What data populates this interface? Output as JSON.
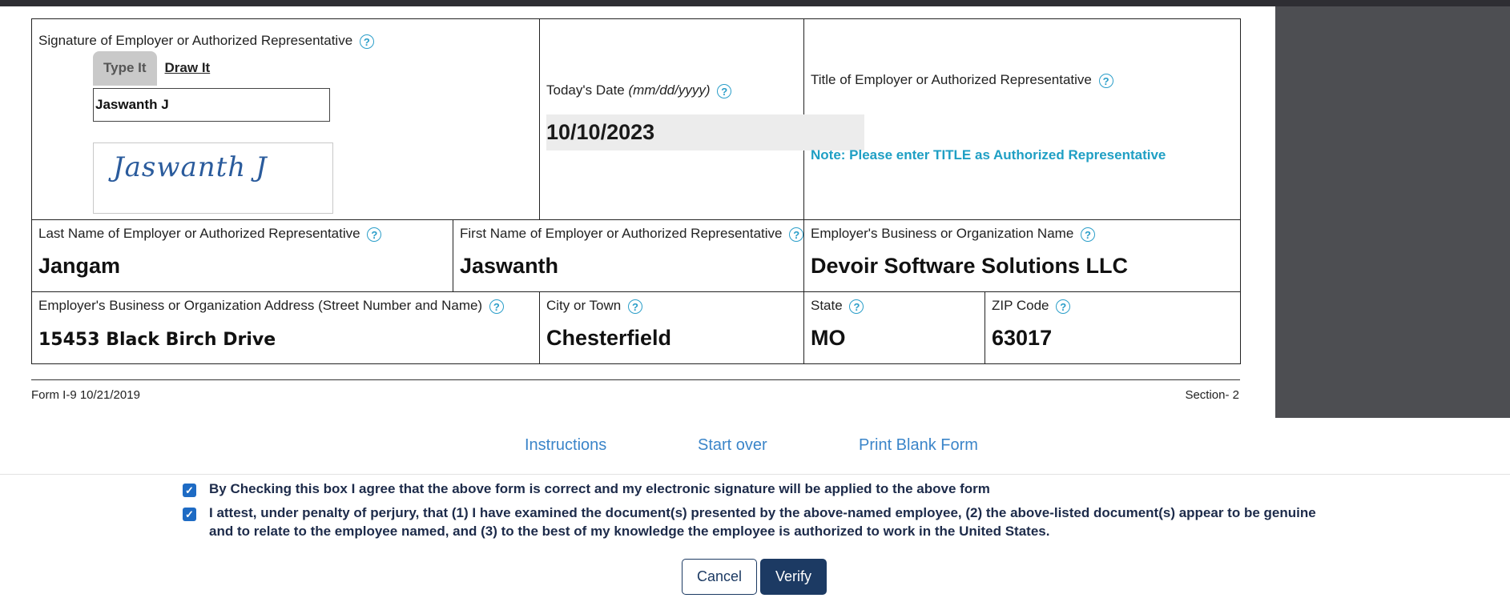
{
  "signature": {
    "label": "Signature of Employer or Authorized Representative",
    "tab_type": "Type It",
    "tab_draw": "Draw It",
    "typed_value": "Jaswanth J",
    "preview_text": "Jaswanth J"
  },
  "date": {
    "label": "Today's Date",
    "label_hint": "(mm/dd/yyyy)",
    "value": "10/10/2023"
  },
  "title": {
    "label": "Title of Employer or Authorized Representative",
    "note": "Note: Please enter TITLE as Authorized Representative"
  },
  "last_name": {
    "label": "Last Name of Employer or Authorized Representative",
    "value": "Jangam"
  },
  "first_name": {
    "label": "First Name of Employer or Authorized Representative",
    "value": "Jaswanth"
  },
  "business_name": {
    "label": "Employer's Business or Organization Name",
    "value": "Devoir Software Solutions LLC"
  },
  "address": {
    "label": "Employer's Business or Organization Address (Street Number and Name)",
    "value": "15453 Black Birch Drive"
  },
  "city": {
    "label": "City or Town",
    "value": "Chesterfield"
  },
  "state": {
    "label": "State",
    "value": "MO"
  },
  "zip": {
    "label": "ZIP Code",
    "value": "63017"
  },
  "footer": {
    "form_id": "Form I-9 10/21/2019",
    "section": "Section- 2"
  },
  "links": {
    "instructions": "Instructions",
    "start_over": "Start over",
    "print_blank": "Print Blank Form"
  },
  "agreements": {
    "agree_text": "By Checking this box I agree that the above form is correct and my electronic signature will be applied to the above form",
    "attest_line1": "I attest, under penalty of perjury, that (1) I have examined the document(s) presented by the above-named employee, (2) the above-listed document(s) appear to be genuine",
    "attest_line2": "and to relate to the employee named, and (3) to the best of my knowledge the employee is authorized to work in the United States."
  },
  "buttons": {
    "cancel": "Cancel",
    "verify": "Verify"
  },
  "help_glyph": "?",
  "check_glyph": "✓",
  "colors": {
    "accent_blue": "#1f9fc4",
    "link_blue": "#3b85c9",
    "button_navy": "#1c3a63",
    "checkbox_blue": "#1e6bc4"
  }
}
